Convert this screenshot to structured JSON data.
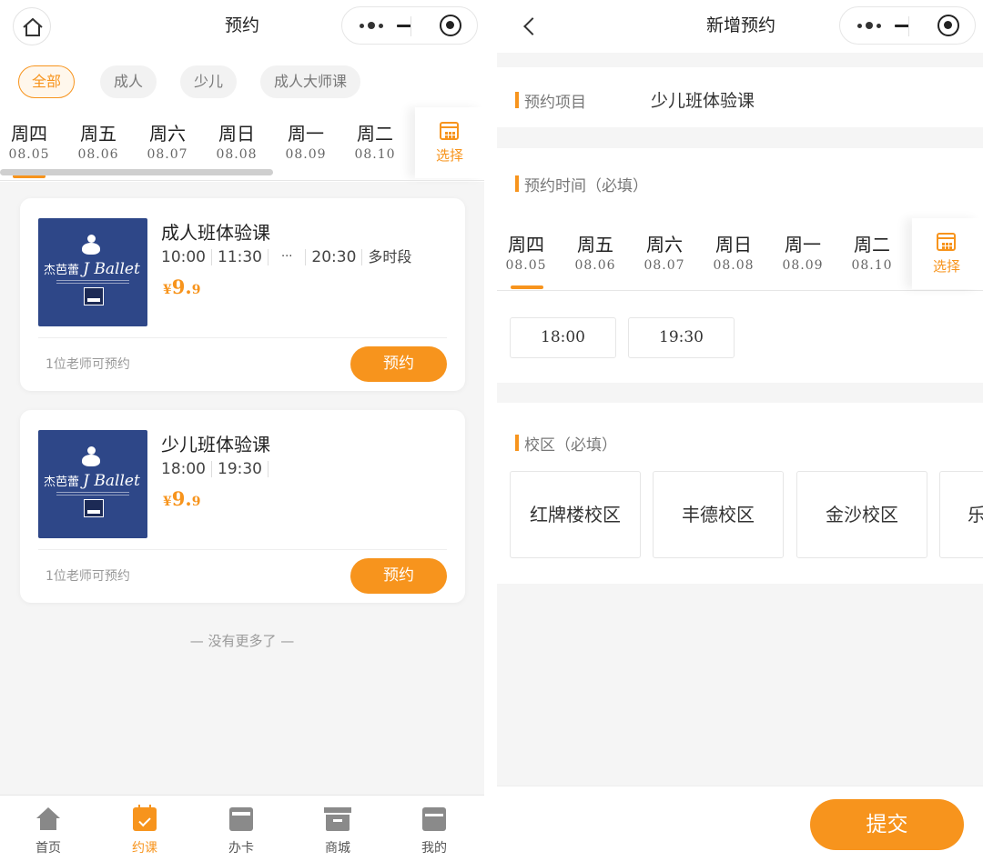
{
  "left": {
    "nav_title": "预约",
    "filters": [
      "全部",
      "成人",
      "少儿",
      "成人大师课"
    ],
    "dates": [
      {
        "weekday": "周四",
        "date": "08.05"
      },
      {
        "weekday": "周五",
        "date": "08.06"
      },
      {
        "weekday": "周六",
        "date": "08.07"
      },
      {
        "weekday": "周日",
        "date": "08.08"
      },
      {
        "weekday": "周一",
        "date": "08.09"
      },
      {
        "weekday": "周二",
        "date": "08.10"
      }
    ],
    "calendar_label": "选择",
    "cards": [
      {
        "title": "成人班体验课",
        "times": [
          "10:00",
          "11:30",
          "···",
          "20:30",
          "多时段"
        ],
        "price_currency": "¥",
        "price_int": "9.",
        "price_dec": "9",
        "thumb_brand": "杰芭蕾",
        "thumb_brand_en": "J Ballet",
        "teacher": "1位老师可预约",
        "book_label": "预约"
      },
      {
        "title": "少儿班体验课",
        "times": [
          "18:00",
          "19:30"
        ],
        "price_currency": "¥",
        "price_int": "9.",
        "price_dec": "9",
        "thumb_brand": "杰芭蕾",
        "thumb_brand_en": "J Ballet",
        "teacher": "1位老师可预约",
        "book_label": "预约"
      }
    ],
    "no_more": "— 没有更多了 —",
    "tabs": [
      {
        "label": "首页",
        "icon": "home-icon"
      },
      {
        "label": "约课",
        "icon": "calendar-check-icon"
      },
      {
        "label": "办卡",
        "icon": "card-icon"
      },
      {
        "label": "商城",
        "icon": "shop-icon"
      },
      {
        "label": "我的",
        "icon": "profile-icon"
      }
    ]
  },
  "right": {
    "nav_title": "新增预约",
    "project_label": "预约项目",
    "project_value": "少儿班体验课",
    "time_label": "预约时间（必填）",
    "dates": [
      {
        "weekday": "周四",
        "date": "08.05"
      },
      {
        "weekday": "周五",
        "date": "08.06"
      },
      {
        "weekday": "周六",
        "date": "08.07"
      },
      {
        "weekday": "周日",
        "date": "08.08"
      },
      {
        "weekday": "周一",
        "date": "08.09"
      },
      {
        "weekday": "周二",
        "date": "08.10"
      }
    ],
    "calendar_label": "选择",
    "time_slots": [
      "18:00",
      "19:30"
    ],
    "campus_label": "校区（必填）",
    "campuses": [
      "红牌楼校区",
      "丰德校区",
      "金沙校区",
      "乐"
    ],
    "submit_label": "提交"
  },
  "colors": {
    "accent": "#f7941d",
    "background": "#f5f5f5",
    "thumb_bg": "#2e4788"
  }
}
